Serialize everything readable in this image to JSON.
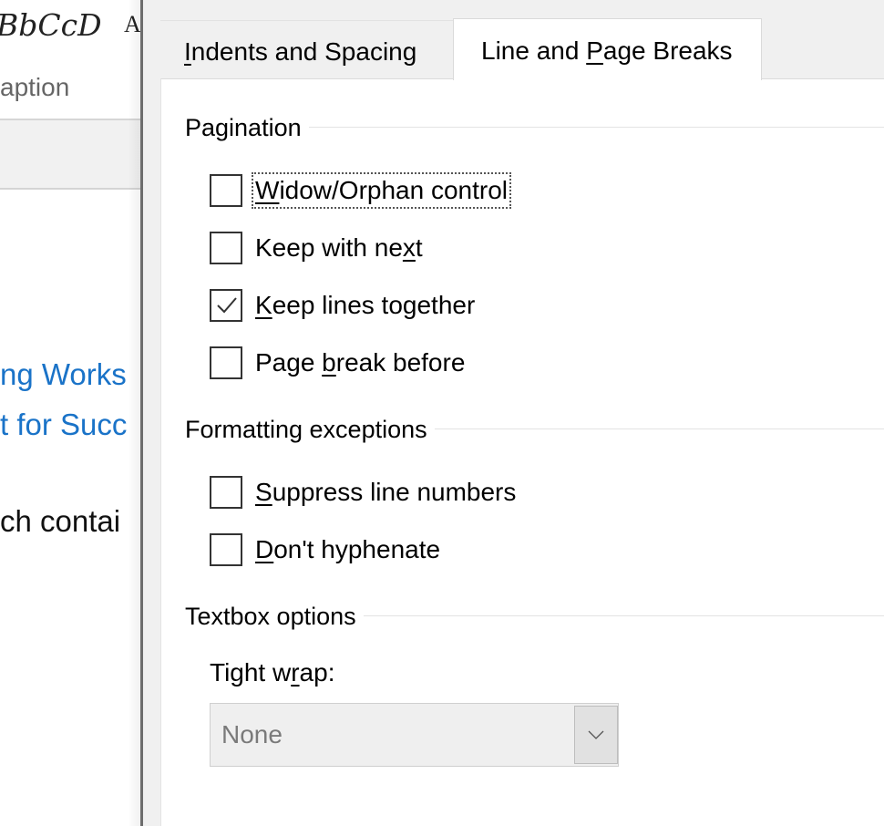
{
  "background_document": {
    "style_gallery": {
      "sample_text": "BbCcD",
      "sample_text_2": "A",
      "style_name": "aption"
    },
    "headings": [
      "ng Works",
      "t for Succ"
    ],
    "heading_color": "#1a73c8",
    "body_text": "ch contai"
  },
  "dialog": {
    "tabs": [
      {
        "label_pre": "",
        "label_accel": "I",
        "label_post": "ndents and Spacing",
        "active": false
      },
      {
        "label_pre": "Line and ",
        "label_accel": "P",
        "label_post": "age Breaks",
        "active": true
      }
    ],
    "groups": {
      "pagination": {
        "label": "Pagination",
        "options": [
          {
            "pre": "",
            "accel": "W",
            "post": "idow/Orphan control",
            "checked": false,
            "focused": true
          },
          {
            "pre": "Keep with ne",
            "accel": "x",
            "post": "t",
            "checked": false,
            "focused": false
          },
          {
            "pre": "",
            "accel": "K",
            "post": "eep lines together",
            "checked": true,
            "focused": false
          },
          {
            "pre": "Page ",
            "accel": "b",
            "post": "reak before",
            "checked": false,
            "focused": false
          }
        ]
      },
      "formatting_exceptions": {
        "label": "Formatting exceptions",
        "options": [
          {
            "pre": "",
            "accel": "S",
            "post": "uppress line numbers",
            "checked": false,
            "focused": false
          },
          {
            "pre": "",
            "accel": "D",
            "post": "on't hyphenate",
            "checked": false,
            "focused": false
          }
        ]
      },
      "textbox_options": {
        "label": "Textbox options",
        "tight_wrap": {
          "label_pre": "Tight w",
          "label_accel": "r",
          "label_post": "ap:",
          "value": "None",
          "disabled": true
        }
      }
    }
  }
}
